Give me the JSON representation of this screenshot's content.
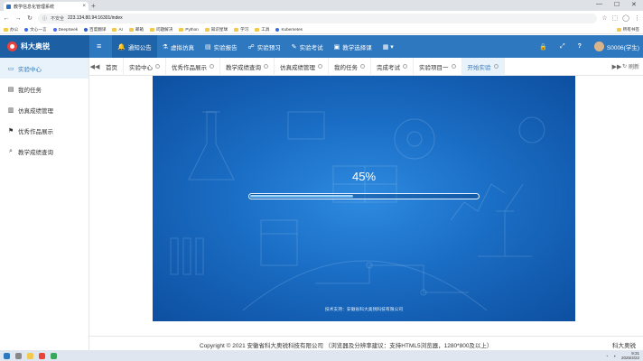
{
  "browser": {
    "tab_title": "教学信息化管理系统",
    "tab_close": "×",
    "new_tab": "+",
    "window_controls": [
      "—",
      "☐",
      "✕"
    ],
    "security_label": "不安全",
    "url": "223.134.80.94:16301/index",
    "bookmarks": [
      {
        "label": "办公",
        "icon": "folder-icon"
      },
      {
        "label": "文心一言",
        "icon": "wenxin-icon"
      },
      {
        "label": "DeepSeek",
        "icon": "deepseek-icon"
      },
      {
        "label": "百度翻译",
        "icon": "baidu-translate-icon"
      },
      {
        "label": "AI",
        "icon": "folder-icon"
      },
      {
        "label": "邮箱",
        "icon": "folder-icon"
      },
      {
        "label": "问题解决",
        "icon": "folder-icon"
      },
      {
        "label": "Python",
        "icon": "folder-icon"
      },
      {
        "label": "知识星球",
        "icon": "folder-icon"
      },
      {
        "label": "学习",
        "icon": "folder-icon"
      },
      {
        "label": "工具",
        "icon": "folder-icon"
      },
      {
        "label": "Kubernetes",
        "icon": "kubernetes-icon"
      }
    ],
    "all_bookmarks": "所有书签"
  },
  "app": {
    "logo_text": "科大奥锐",
    "top_nav": [
      {
        "label": "通知公告",
        "icon": "bell-icon",
        "glyph": "🔔",
        "active": true
      },
      {
        "label": "虚拟仿真",
        "icon": "flask-icon",
        "glyph": "⚗"
      },
      {
        "label": "实验报告",
        "icon": "report-icon",
        "glyph": "▤"
      },
      {
        "label": "实验预习",
        "icon": "people-icon",
        "glyph": "☍"
      },
      {
        "label": "实验考试",
        "icon": "pen-icon",
        "glyph": "✎"
      },
      {
        "label": "教学选择课",
        "icon": "book-icon",
        "glyph": "▣"
      },
      {
        "label": "",
        "icon": "more-icon",
        "glyph": "▦ ▾"
      }
    ],
    "header_right": {
      "lock_glyph": "🔒",
      "fullscreen_glyph": "⤢",
      "help_glyph": "?",
      "user": "S0006(学生)"
    }
  },
  "sidebar": {
    "items": [
      {
        "label": "实验中心",
        "icon": "monitor-icon",
        "glyph": "▭",
        "active": true
      },
      {
        "label": "我的任务",
        "icon": "tasks-icon",
        "glyph": "▤"
      },
      {
        "label": "仿真成绩管理",
        "icon": "chart-icon",
        "glyph": "▥"
      },
      {
        "label": "优秀作品展示",
        "icon": "flag-icon",
        "glyph": "⚑"
      },
      {
        "label": "教学成绩查询",
        "icon": "search-doc-icon",
        "glyph": "⌕"
      }
    ]
  },
  "page_tabs": {
    "prev": "◀◀",
    "next": "▶▶",
    "refresh": "刷新",
    "items": [
      {
        "label": "首页",
        "closable": false
      },
      {
        "label": "实验中心",
        "closable": true
      },
      {
        "label": "优秀作品展示",
        "closable": true
      },
      {
        "label": "教学成绩查询",
        "closable": true
      },
      {
        "label": "仿真成绩管理",
        "closable": true
      },
      {
        "label": "我的任务",
        "closable": true
      },
      {
        "label": "完成考试",
        "closable": true
      },
      {
        "label": "实验项目一",
        "closable": true
      },
      {
        "label": "开始实验",
        "closable": true,
        "active": true
      }
    ]
  },
  "loader": {
    "progress_text": "45%",
    "progress": 0.45,
    "tech_support": "技术支持：安徽省科大奥锐科技有限公司"
  },
  "footer": {
    "copyright": "Copyright © 2021 安徽省科大奥锐科技有限公司 （浏览器及分辨率建议：支持HTML5浏览器，1280*800及以上）",
    "brand": "科大奥锐"
  },
  "taskbar": {
    "time": "9:31",
    "date": "2025/4/22"
  }
}
